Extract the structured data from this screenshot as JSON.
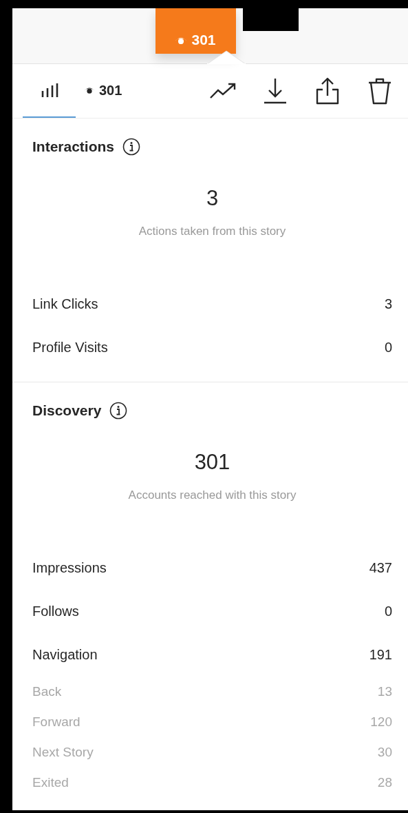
{
  "thumbnail": {
    "views": "301"
  },
  "toolbar": {
    "tabs": [
      {
        "kind": "insights",
        "selected": true
      },
      {
        "kind": "views",
        "label": "301",
        "selected": false
      }
    ],
    "actions": [
      {
        "kind": "trend"
      },
      {
        "kind": "download"
      },
      {
        "kind": "share"
      },
      {
        "kind": "delete"
      }
    ]
  },
  "sections": [
    {
      "title": "Interactions",
      "total": "3",
      "caption": "Actions taken from this story",
      "rows": [
        {
          "kind": "main",
          "label": "Link Clicks",
          "value": "3"
        },
        {
          "kind": "main",
          "label": "Profile Visits",
          "value": "0"
        }
      ]
    },
    {
      "title": "Discovery",
      "total": "301",
      "caption": "Accounts reached with this story",
      "rows": [
        {
          "kind": "main",
          "label": "Impressions",
          "value": "437"
        },
        {
          "kind": "main",
          "label": "Follows",
          "value": "0"
        },
        {
          "kind": "main",
          "label": "Navigation",
          "value": "191",
          "children": [
            {
              "kind": "sub",
              "label": "Back",
              "value": "13"
            },
            {
              "kind": "sub",
              "label": "Forward",
              "value": "120"
            },
            {
              "kind": "sub",
              "label": "Next Story",
              "value": "30"
            },
            {
              "kind": "sub",
              "label": "Exited",
              "value": "28"
            }
          ]
        }
      ]
    }
  ]
}
